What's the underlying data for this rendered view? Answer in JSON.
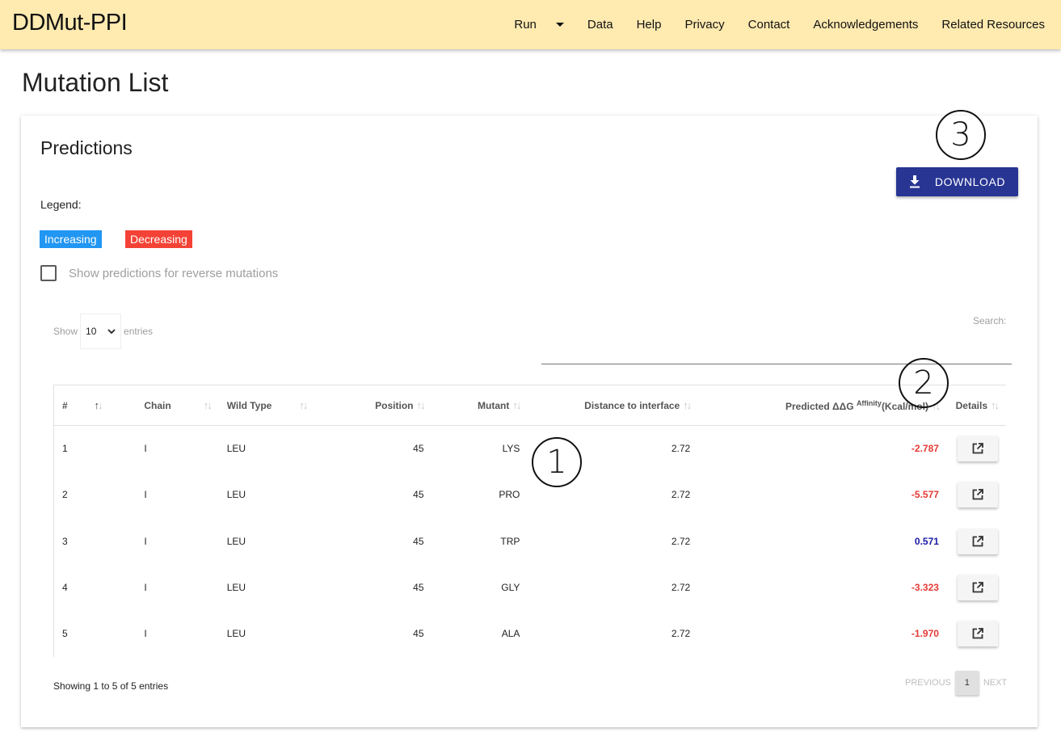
{
  "navbar": {
    "brand": "DDMut-PPI",
    "items": [
      {
        "label": "Run",
        "has_dropdown": true
      },
      {
        "label": "Data"
      },
      {
        "label": "Help"
      },
      {
        "label": "Privacy"
      },
      {
        "label": "Contact"
      },
      {
        "label": "Acknowledgements"
      },
      {
        "label": "Related Resources"
      }
    ]
  },
  "page": {
    "title": "Mutation List"
  },
  "card": {
    "title": "Predictions",
    "download_label": "DOWNLOAD",
    "legend_label": "Legend:",
    "legend": {
      "increasing": "Increasing",
      "decreasing": "Decreasing"
    },
    "legend_colors": {
      "increasing": "#2196f3",
      "decreasing": "#f44336"
    },
    "reverse_checkbox": {
      "label": "Show predictions for reverse mutations",
      "checked": false
    }
  },
  "table_controls": {
    "show_label": "Show",
    "entries_label": "entries",
    "page_length": "10",
    "search_label": "Search:",
    "search_value": ""
  },
  "table": {
    "columns": [
      "#",
      "Chain",
      "Wild Type",
      "Position",
      "Mutant",
      "Distance to interface",
      "Predicted ΔΔG",
      "Affinity",
      "(Kcal/mol)",
      "Details"
    ],
    "rows": [
      {
        "num": "1",
        "chain": "I",
        "wild_type": "LEU",
        "position": "45",
        "mutant": "LYS",
        "distance": "2.72",
        "ddg": "-2.787",
        "effect": "decreasing"
      },
      {
        "num": "2",
        "chain": "I",
        "wild_type": "LEU",
        "position": "45",
        "mutant": "PRO",
        "distance": "2.72",
        "ddg": "-5.577",
        "effect": "decreasing"
      },
      {
        "num": "3",
        "chain": "I",
        "wild_type": "LEU",
        "position": "45",
        "mutant": "TRP",
        "distance": "2.72",
        "ddg": "0.571",
        "effect": "increasing"
      },
      {
        "num": "4",
        "chain": "I",
        "wild_type": "LEU",
        "position": "45",
        "mutant": "GLY",
        "distance": "2.72",
        "ddg": "-3.323",
        "effect": "decreasing"
      },
      {
        "num": "5",
        "chain": "I",
        "wild_type": "LEU",
        "position": "45",
        "mutant": "ALA",
        "distance": "2.72",
        "ddg": "-1.970",
        "effect": "decreasing"
      }
    ],
    "details_icon": "open-in-new-icon"
  },
  "footer": {
    "info": "Showing 1 to 5 of 5 entries",
    "previous": "PREVIOUS",
    "current_page": "1",
    "next": "NEXT"
  },
  "annotations": [
    "1",
    "2",
    "3"
  ]
}
